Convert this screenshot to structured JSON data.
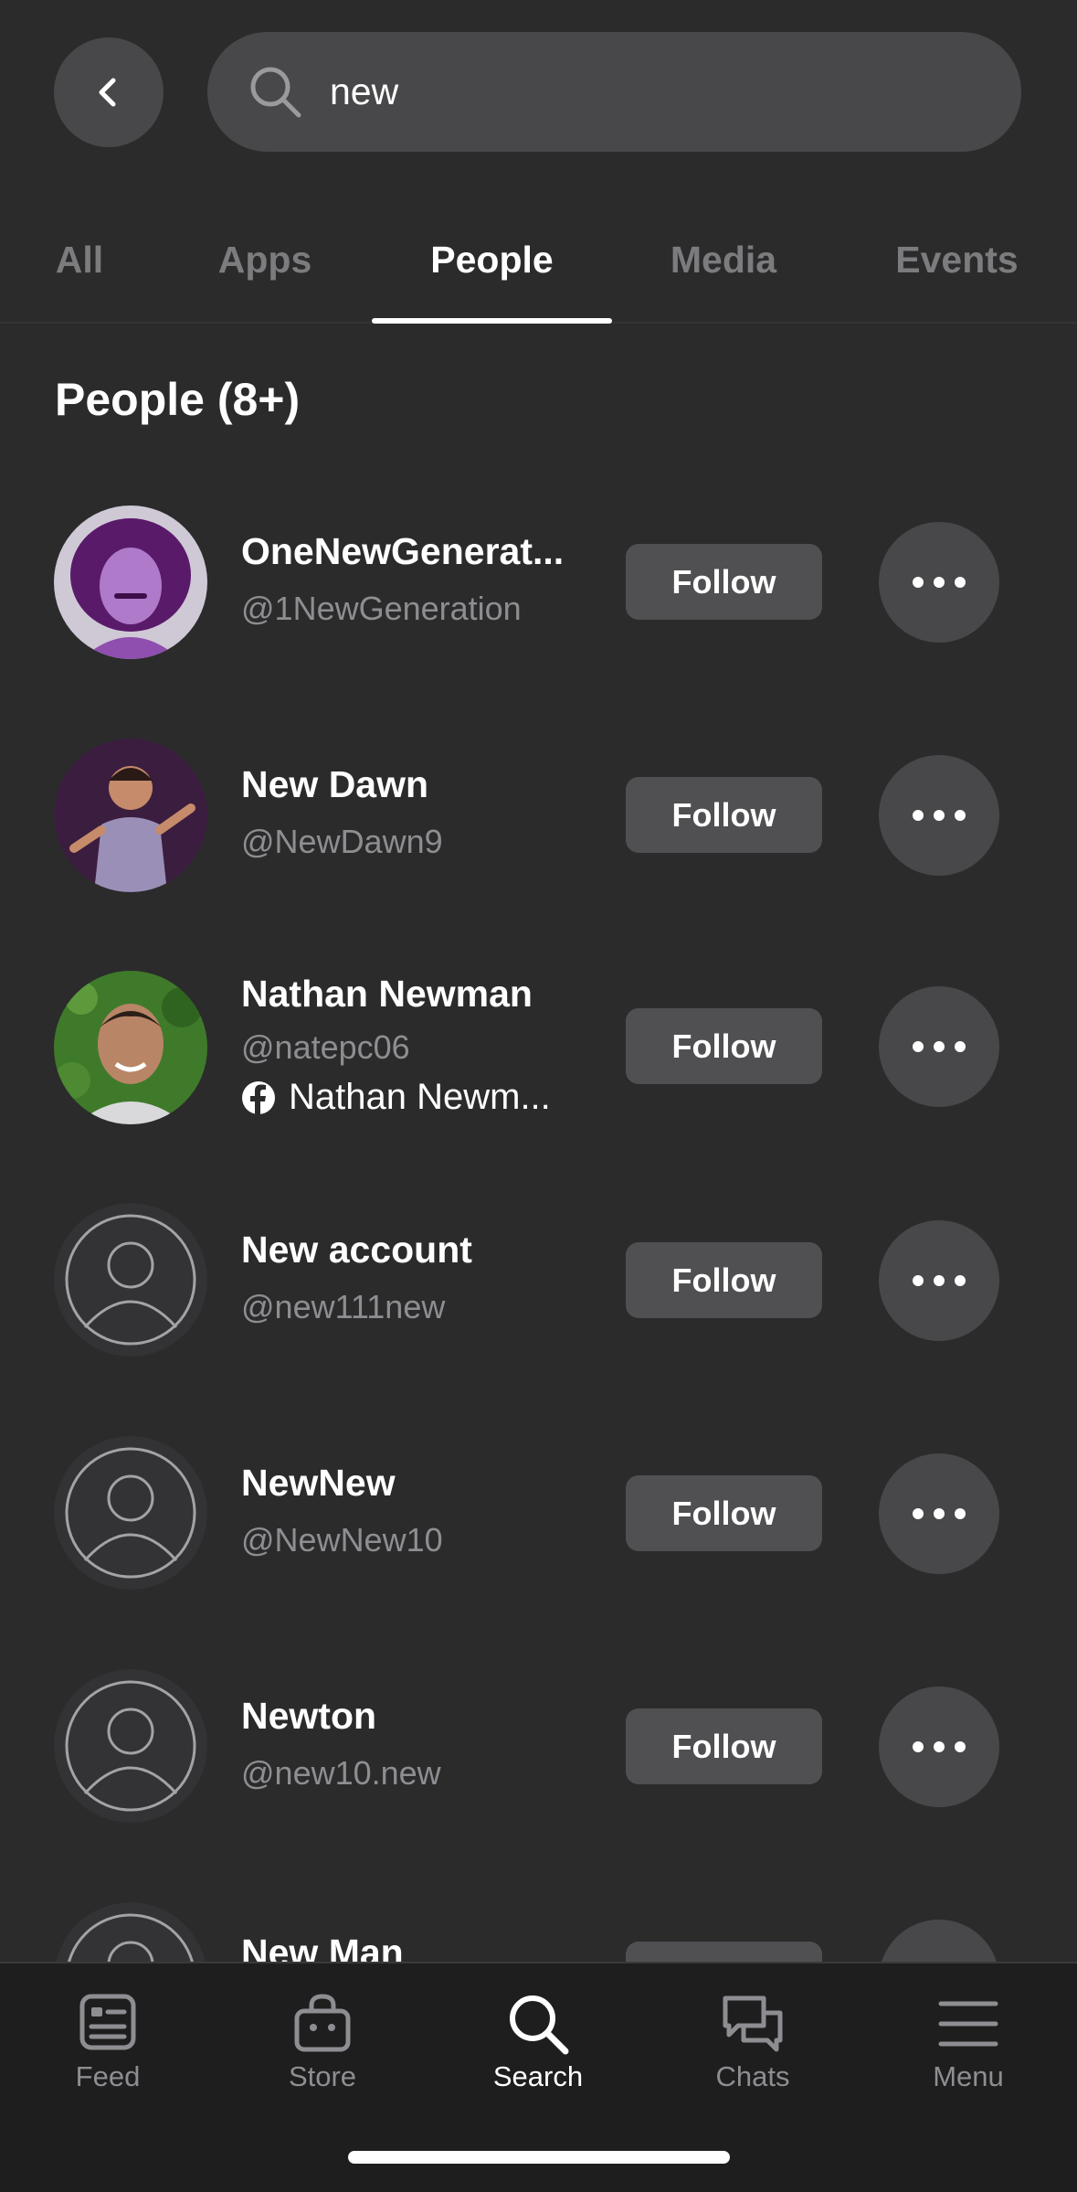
{
  "search": {
    "query": "new"
  },
  "tabs": [
    {
      "label": "All"
    },
    {
      "label": "Apps"
    },
    {
      "label": "People"
    },
    {
      "label": "Media"
    },
    {
      "label": "Events"
    }
  ],
  "active_tab": "People",
  "section_title": "People (8+)",
  "people": [
    {
      "name": "OneNewGenerat...",
      "handle": "@1NewGeneration",
      "follow_label": "Follow"
    },
    {
      "name": "New Dawn",
      "handle": "@NewDawn9",
      "follow_label": "Follow"
    },
    {
      "name": "Nathan Newman",
      "handle": "@natepc06",
      "facebook_name": "Nathan Newm...",
      "follow_label": "Follow"
    },
    {
      "name": "New account",
      "handle": "@new111new",
      "follow_label": "Follow"
    },
    {
      "name": "NewNew",
      "handle": "@NewNew10",
      "follow_label": "Follow"
    },
    {
      "name": "Newton",
      "handle": "@new10.new",
      "follow_label": "Follow"
    },
    {
      "name": "New Man",
      "handle": "",
      "follow_label": ""
    }
  ],
  "bottom_nav": [
    {
      "label": "Feed",
      "icon": "feed-icon"
    },
    {
      "label": "Store",
      "icon": "store-icon"
    },
    {
      "label": "Search",
      "icon": "search-icon"
    },
    {
      "label": "Chats",
      "icon": "chats-icon"
    },
    {
      "label": "Menu",
      "icon": "menu-icon"
    }
  ],
  "active_nav": "Search",
  "colors": {
    "background": "#2b2b2c",
    "surface": "#48484a",
    "button": "#505053",
    "secondary_text": "#8e8e92",
    "nav_background": "#1e1e1f"
  }
}
